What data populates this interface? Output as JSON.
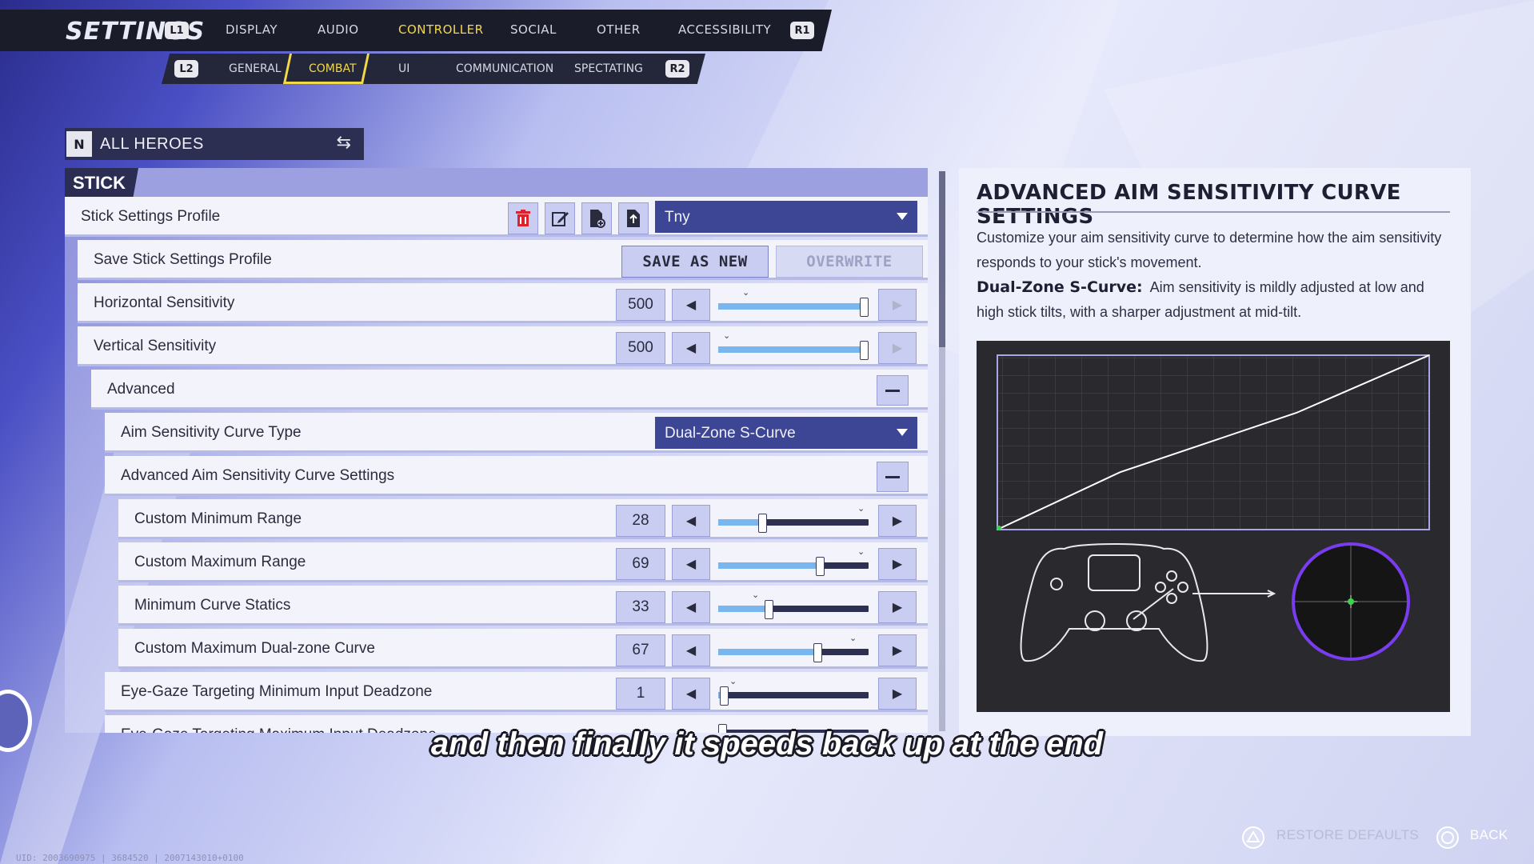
{
  "topnav": {
    "title": "SETTINGS",
    "left_key": "L1",
    "right_key": "R1",
    "tabs": [
      "DISPLAY",
      "AUDIO",
      "CONTROLLER",
      "SOCIAL",
      "OTHER",
      "ACCESSIBILITY"
    ],
    "active_tab": "CONTROLLER"
  },
  "subnav": {
    "left_key": "L2",
    "right_key": "R2",
    "tabs": [
      "GENERAL",
      "COMBAT",
      "UI",
      "COMMUNICATION",
      "SPECTATING"
    ],
    "active_tab": "COMBAT"
  },
  "hero_selector": {
    "label": "ALL HEROES",
    "logo": "N"
  },
  "section": {
    "label": "STICK"
  },
  "rows": {
    "profile": {
      "label": "Stick Settings Profile",
      "dropdown_value": "Tny"
    },
    "save_profile": {
      "label": "Save Stick Settings Profile",
      "save_as_new": "SAVE AS NEW",
      "overwrite": "OVERWRITE"
    },
    "horizontal": {
      "label": "Horizontal Sensitivity",
      "value": "500"
    },
    "vertical": {
      "label": "Vertical Sensitivity",
      "value": "500"
    },
    "advanced": {
      "label": "Advanced"
    },
    "curve_type": {
      "label": "Aim Sensitivity Curve Type",
      "dropdown_value": "Dual-Zone S-Curve"
    },
    "adv_curve": {
      "label": "Advanced Aim Sensitivity Curve Settings"
    },
    "min_range": {
      "label": "Custom Minimum Range",
      "value": "28"
    },
    "max_range": {
      "label": "Custom Maximum Range",
      "value": "69"
    },
    "min_statics": {
      "label": "Minimum Curve Statics",
      "value": "33"
    },
    "max_dual": {
      "label": "Custom Maximum Dual-zone Curve",
      "value": "67"
    },
    "eye_min": {
      "label": "Eye-Gaze Targeting Minimum Input Deadzone",
      "value": "1"
    },
    "eye_max": {
      "label": "Eye-Gaze Targeting Maximum Input Deadzone"
    }
  },
  "slider_levels": {
    "horizontal": 1.0,
    "vertical": 1.0,
    "min_range": 0.28,
    "max_range": 0.69,
    "min_statics": 0.33,
    "max_dual": 0.67,
    "eye_min": 0.01
  },
  "info_panel": {
    "title": "ADVANCED AIM SENSITIVITY CURVE SETTINGS",
    "desc1": "Customize your aim sensitivity curve to determine how the aim sensitivity responds to your stick's movement.",
    "term": "Dual-Zone S-Curve:",
    "desc2": "Aim sensitivity is mildly adjusted at low and high stick tilts, with a sharper adjustment at mid-tilt."
  },
  "subtitle": "and then finally it speeds back up at the end",
  "footer": {
    "restore": "RESTORE DEFAULTS",
    "back": "BACK"
  },
  "uid": "UID: 2003690975 | 3684520 | 2007143010+0100",
  "colors": {
    "accent_yellow": "#f2d94a",
    "panel_blue": "#3d4694",
    "slider_fill": "#7ab6ee",
    "delete_red": "#d92430"
  }
}
